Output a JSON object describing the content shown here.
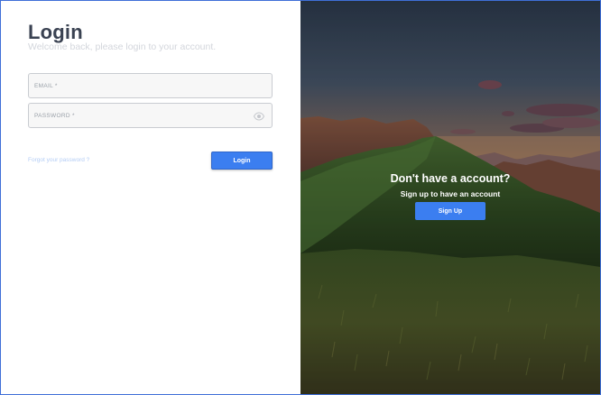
{
  "login": {
    "title": "Login",
    "subtitle": "Welcome back, please login to your account.",
    "email": {
      "placeholder": "EMAIL *",
      "value": ""
    },
    "password": {
      "placeholder": "PASSWORD *",
      "value": "",
      "toggle_icon": "eye-icon"
    },
    "forgot_label": "Forgot your password ?",
    "submit_label": "Login"
  },
  "signup": {
    "heading": "Don't have a account?",
    "subheading": "Sign up to have an account",
    "button_label": "Sign Up"
  },
  "colors": {
    "accent": "#3b7ef0",
    "title": "#3a4252",
    "subtitle": "#d3d6dc",
    "link": "#b4cdf5",
    "frame_border": "#3f6fd8"
  }
}
